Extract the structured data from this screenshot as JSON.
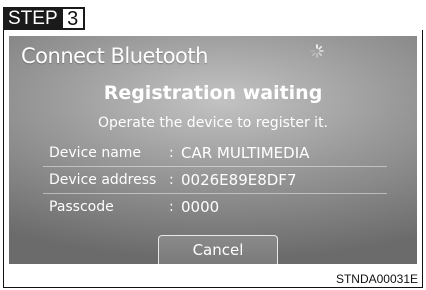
{
  "step": {
    "word": "STEP",
    "number": "3"
  },
  "screen": {
    "title": "Connect Bluetooth",
    "status_title": "Registration waiting",
    "status_message": "Operate the device to register it.",
    "info": [
      {
        "label": "Device name",
        "value": "CAR MULTIMEDIA"
      },
      {
        "label": "Device address",
        "value": "0026E89E8DF7"
      },
      {
        "label": "Passcode",
        "value": "0000"
      }
    ],
    "separator": ":",
    "cancel_label": "Cancel",
    "busy_icon": "spinner-icon"
  },
  "figure_code": "STNDA00031E"
}
